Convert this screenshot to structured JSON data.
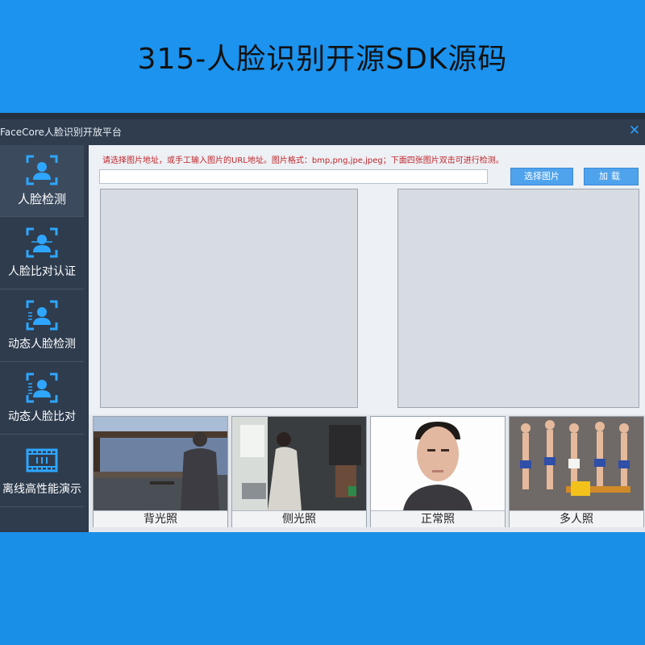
{
  "banner": {
    "title": "315-人脸识别开源SDK源码"
  },
  "window": {
    "title": "FaceCore人脸识别开放平台",
    "close_glyph": "✕"
  },
  "sidebar": {
    "items": [
      {
        "label": "人脸检测",
        "icon": "face-detect-icon",
        "active": true
      },
      {
        "label": "人脸比对认证",
        "icon": "face-compare-icon",
        "active": false
      },
      {
        "label": "动态人脸检测",
        "icon": "dynamic-face-detect-icon",
        "active": false
      },
      {
        "label": "动态人脸比对",
        "icon": "dynamic-face-compare-icon",
        "active": false
      },
      {
        "label": "离线高性能演示",
        "icon": "film-icon",
        "active": false
      }
    ]
  },
  "main": {
    "hint": "请选择图片地址，或手工输入图片的URL地址。图片格式：bmp,png,jpe,jpeg；下面四张图片双击可进行检测。",
    "url_input": {
      "value": "",
      "placeholder": ""
    },
    "select_button": "选择图片",
    "load_button": "加载",
    "thumbnails": [
      {
        "label": "背光照"
      },
      {
        "label": "侧光照"
      },
      {
        "label": "正常照"
      },
      {
        "label": "多人照"
      }
    ]
  },
  "colors": {
    "background": "#1a8fe8",
    "sidebar": "#2e3c4e",
    "accent": "#4fa3ec",
    "hint_text": "#c0262b",
    "close": "#2aa0ff"
  }
}
